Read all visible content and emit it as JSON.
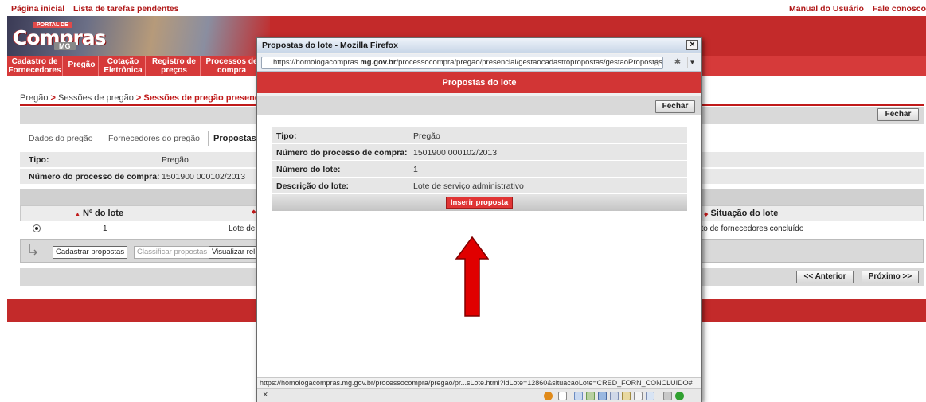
{
  "top_links": {
    "left": [
      "Página inicial",
      "Lista de tarefas pendentes"
    ],
    "right": [
      "Manual do Usuário",
      "Fale conosco"
    ]
  },
  "logo": {
    "top_text": "PORTAL DE",
    "main_text": "Compras",
    "sub_text": "MG"
  },
  "nav": [
    {
      "line1": "Cadastro de",
      "line2": "Fornecedores"
    },
    {
      "line1": "Pregão",
      "line2": ""
    },
    {
      "line1": "Cotação",
      "line2": "Eletrônica"
    },
    {
      "line1": "Registro de",
      "line2": "preços"
    },
    {
      "line1": "Processos de",
      "line2": "compra"
    }
  ],
  "breadcrumb": {
    "parts": [
      "Pregão",
      "Sessões de pregão",
      "Sessões de pregão presencial"
    ],
    "separator": ">"
  },
  "buttons": {
    "fechar": "Fechar",
    "anterior": "<< Anterior",
    "proximo": "Próximo >>"
  },
  "tabs": [
    "Dados do pregão",
    "Fornecedores do pregão",
    "Propostas"
  ],
  "info": {
    "tipo_label": "Tipo:",
    "tipo_value": "Pregão",
    "processo_label": "Número do processo de compra:",
    "processo_value": "1501900 000102/2013"
  },
  "table": {
    "headers": [
      "Nº do lote",
      "",
      "Situação do lote"
    ],
    "sort_up": "▲",
    "sort_both": "◆",
    "row": {
      "num": "1",
      "desc": "Lote de",
      "situacao": "mento de fornecedores concluído"
    }
  },
  "actions": {
    "cadastrar": "Cadastrar propostas",
    "classificar": "Classificar propostas",
    "visualizar": "Visualizar rel"
  },
  "popup": {
    "window_title": "Propostas do lote - Mozilla Firefox",
    "url_prefix": "https://homologacompras.",
    "url_domain": "mg.gov.br",
    "url_suffix": "/processocompra/pregao/presencial/gestaocadastropropostas/gestaoPropostasL",
    "header": "Propostas do lote",
    "fechar": "Fechar",
    "rows": [
      {
        "label": "Tipo:",
        "value": "Pregão"
      },
      {
        "label": "Número do processo de compra:",
        "value": "1501900 000102/2013"
      },
      {
        "label": "Número do lote:",
        "value": "1"
      },
      {
        "label": "Descrição do lote:",
        "value": "Lote de serviço administrativo"
      }
    ],
    "insert_button": "Inserir proposta",
    "status_url": "https://homologacompras.mg.gov.br/processocompra/pregao/pr...sLote.html?idLote=12860&situacaoLote=CRED_FORN_CONCLUIDO#",
    "addon_close": "×"
  },
  "colors": {
    "brand_red": "#c32a2a",
    "header_red": "#d23535",
    "arrow_red": "#e00000"
  },
  "icons": {
    "lock": "lock-icon",
    "star": "star-icon",
    "close": "close-icon",
    "row_arrow": "corner-arrow-icon",
    "radio": "radio-selected-icon"
  }
}
